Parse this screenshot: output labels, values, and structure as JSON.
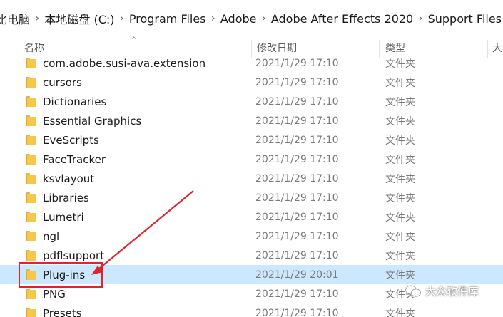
{
  "breadcrumb": [
    "比电脑",
    "本地磁盘 (C:)",
    "Program Files",
    "Adobe",
    "Adobe After Effects 2020",
    "Support Files"
  ],
  "columns": {
    "name": "名称",
    "date": "修改日期",
    "type": "类型",
    "size": "大"
  },
  "rows": [
    {
      "name": "com.adobe.susi-ava.extension",
      "date": "2021/1/29 17:10",
      "type": "文件夹"
    },
    {
      "name": "cursors",
      "date": "2021/1/29 17:10",
      "type": "文件夹"
    },
    {
      "name": "Dictionaries",
      "date": "2021/1/29 17:10",
      "type": "文件夹"
    },
    {
      "name": "Essential Graphics",
      "date": "2021/1/29 17:10",
      "type": "文件夹"
    },
    {
      "name": "EveScripts",
      "date": "2021/1/29 17:10",
      "type": "文件夹"
    },
    {
      "name": "FaceTracker",
      "date": "2021/1/29 17:10",
      "type": "文件夹"
    },
    {
      "name": "ksvlayout",
      "date": "2021/1/29 17:10",
      "type": "文件夹"
    },
    {
      "name": "Libraries",
      "date": "2021/1/29 17:10",
      "type": "文件夹"
    },
    {
      "name": "Lumetri",
      "date": "2021/1/29 17:10",
      "type": "文件夹"
    },
    {
      "name": "ngl",
      "date": "2021/1/29 17:10",
      "type": "文件夹"
    },
    {
      "name": "pdflsupport",
      "date": "2021/1/29 17:10",
      "type": "文件夹"
    },
    {
      "name": "Plug-ins",
      "date": "2021/1/29 20:01",
      "type": "文件夹",
      "selected": true
    },
    {
      "name": "PNG",
      "date": "2021/1/29 17:10",
      "type": "文件夹"
    },
    {
      "name": "Presets",
      "date": "2021/1/29 17:10",
      "type": "文件夹"
    }
  ],
  "watermark": "大众软件库",
  "colors": {
    "selection": "#cce8ff",
    "annotation": "#e0242c",
    "folder": "#f5c84c"
  }
}
